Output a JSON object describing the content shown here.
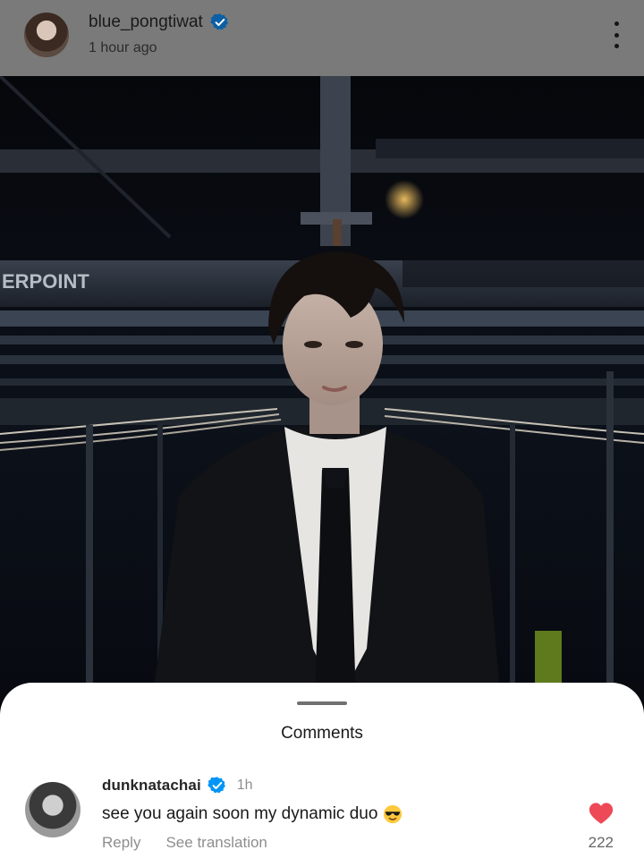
{
  "post": {
    "username": "blue_pongtiwat",
    "time": "1 hour ago",
    "more_icon": "more-vertical-icon",
    "photo_sign_text": "ERPOINT"
  },
  "comments_sheet": {
    "title": "Comments",
    "comments": [
      {
        "username": "dunknatachai",
        "time": "1h",
        "text": "see you again soon my dynamic duo",
        "emoji": "smiling-face-with-sunglasses",
        "reply_label": "Reply",
        "translate_label": "See translation",
        "likes": "222"
      }
    ]
  },
  "colors": {
    "verified": "#0095f6",
    "like": "#ed4956",
    "header_dim": "#7a7a7a"
  }
}
